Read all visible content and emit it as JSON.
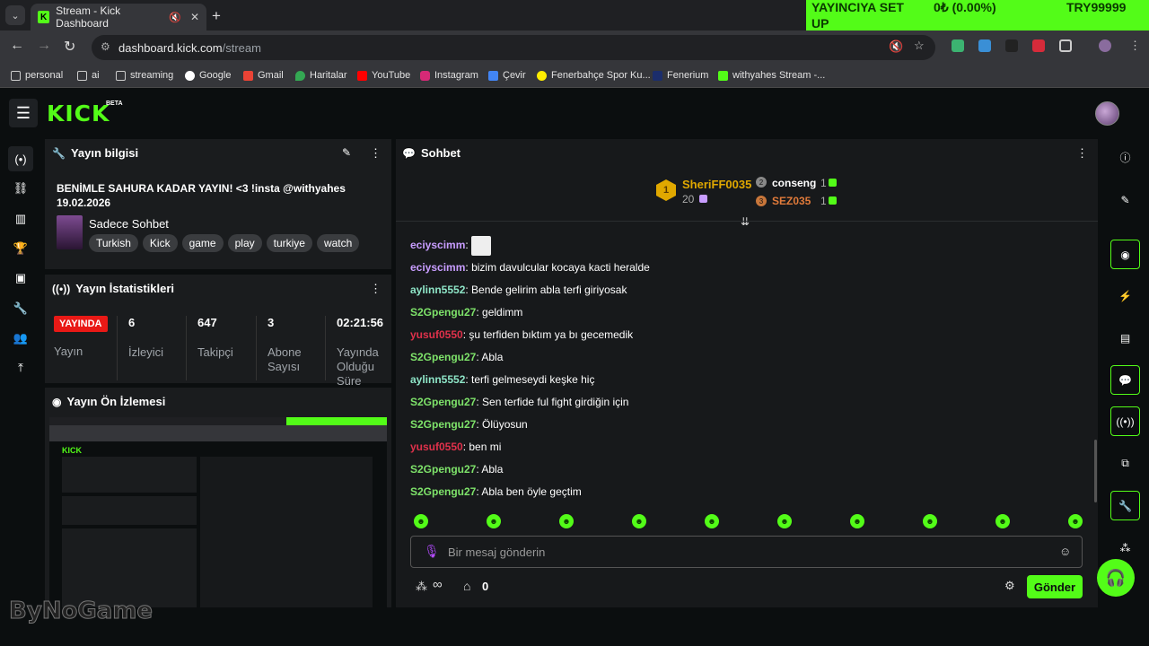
{
  "browser": {
    "tab_title": "Stream - Kick Dashboard",
    "url_host": "dashboard.kick.com",
    "url_path": "/stream",
    "ticker": {
      "a": "YAYINCIYA SET",
      "b": "UP",
      "c": "0₺ (0.00%)",
      "d": "TRY99999"
    },
    "bookmarks": [
      "personal",
      "ai",
      "streaming",
      "Google",
      "Gmail",
      "Haritalar",
      "YouTube",
      "Instagram",
      "Çevir",
      "Fenerbahçe Spor Ku...",
      "Fenerium",
      "withyahes Stream -..."
    ]
  },
  "app": {
    "logo": "KICK",
    "beta": "BETA"
  },
  "stream_info": {
    "header": "Yayın bilgisi",
    "title_line1": "BENİMLE SAHURA KADAR YAYIN! <3 !insta @withyahes",
    "title_line2": "19.02.2026",
    "category": "Sadece Sohbet",
    "tags": [
      "Turkish",
      "Kick",
      "game",
      "play",
      "turkiye",
      "watch"
    ]
  },
  "stream_stats": {
    "header": "Yayın İstatistikleri",
    "live_badge": "YAYINDA",
    "live_label": "Yayın",
    "viewers": "6",
    "viewers_label": "İzleyici",
    "followers": "647",
    "followers_label": "Takipçi",
    "subs": "3",
    "subs_label": "Abone Sayısı",
    "uptime": "02:21:56",
    "uptime_label": "Yayında Olduğu Süre"
  },
  "preview": {
    "header": "Yayın Ön İzlemesi"
  },
  "chat": {
    "header": "Sohbet",
    "leaderboard": {
      "first_name": "SheriFF0035",
      "first_count": "20",
      "second_name": "conseng",
      "second_count": "1",
      "third_name": "SEZ035",
      "third_count": "1"
    },
    "messages": [
      {
        "user": "eciyscimm",
        "color": "#c89dff",
        "text": ""
      },
      {
        "user": "eciyscimm",
        "color": "#c89dff",
        "text": "bizim davulcular kocaya kacti heralde"
      },
      {
        "user": "aylinn5552",
        "color": "#8ee5c7",
        "text": "Bende gelirim abla terfi giriyosak"
      },
      {
        "user": "S2Gpengu27",
        "color": "#7ee36a",
        "text": "geldimm"
      },
      {
        "user": "yusuf0550",
        "color": "#e0314b",
        "text": "şu terfiden bıktım ya bı gecemedik"
      },
      {
        "user": "S2Gpengu27",
        "color": "#7ee36a",
        "text": "Abla"
      },
      {
        "user": "aylinn5552",
        "color": "#8ee5c7",
        "text": "terfi gelmeseydi keşke hiç"
      },
      {
        "user": "S2Gpengu27",
        "color": "#7ee36a",
        "text": "Sen terfide ful fight girdiğin için"
      },
      {
        "user": "S2Gpengu27",
        "color": "#7ee36a",
        "text": "Ölüyosun"
      },
      {
        "user": "yusuf0550",
        "color": "#e0314b",
        "text": "ben mi"
      },
      {
        "user": "S2Gpengu27",
        "color": "#7ee36a",
        "text": "Abla"
      },
      {
        "user": "S2Gpengu27",
        "color": "#7ee36a",
        "text": "Abla ben öyle geçtim"
      }
    ],
    "input_placeholder": "Bir mesaj gönderin",
    "points": "∞",
    "store_count": "0",
    "send_label": "Gönder"
  },
  "watermark": "ByNoGame",
  "colors": {
    "accent": "#53fc18",
    "live": "#e91916"
  }
}
